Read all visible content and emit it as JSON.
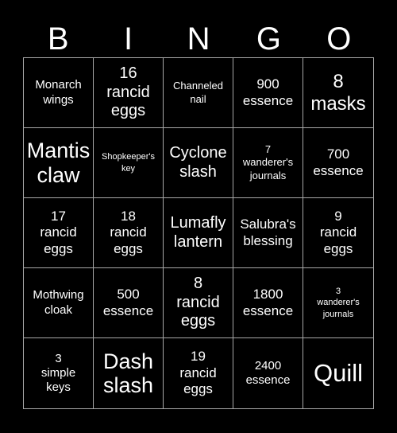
{
  "card": {
    "title": "BINGO",
    "background_color": "#000000",
    "text_color": "#ffffff",
    "grid_line_color": "#a8a8a8",
    "columns": 5,
    "rows": 5
  },
  "header": {
    "letters": [
      {
        "label": "B"
      },
      {
        "label": "I"
      },
      {
        "label": "N"
      },
      {
        "label": "G"
      },
      {
        "label": "O"
      }
    ]
  },
  "grid": {
    "cells": [
      {
        "text": "Monarch\nwings",
        "size": "md"
      },
      {
        "text": "16\nrancid\neggs",
        "size": "xl"
      },
      {
        "text": "Channeled\nnail",
        "size": "sm"
      },
      {
        "text": "900\nessence",
        "size": "lg"
      },
      {
        "text": "8\nmasks",
        "size": "2xl"
      },
      {
        "text": "Mantis\nclaw",
        "size": "3xl"
      },
      {
        "text": "Shopkeeper's\nkey",
        "size": "xs"
      },
      {
        "text": "Cyclone\nslash",
        "size": "xl"
      },
      {
        "text": "7\nwanderer's\njournals",
        "size": "sm"
      },
      {
        "text": "700\nessence",
        "size": "lg"
      },
      {
        "text": "17\nrancid\neggs",
        "size": "lg"
      },
      {
        "text": "18\nrancid\neggs",
        "size": "lg"
      },
      {
        "text": "Lumafly\nlantern",
        "size": "xl"
      },
      {
        "text": "Salubra's\nblessing",
        "size": "lg"
      },
      {
        "text": "9\nrancid\neggs",
        "size": "lg"
      },
      {
        "text": "Mothwing\ncloak",
        "size": "md"
      },
      {
        "text": "500\nessence",
        "size": "lg"
      },
      {
        "text": "8\nrancid\neggs",
        "size": "xl"
      },
      {
        "text": "1800\nessence",
        "size": "lg"
      },
      {
        "text": "3\nwanderer's\njournals",
        "size": "xs"
      },
      {
        "text": "3\nsimple\nkeys",
        "size": "md"
      },
      {
        "text": "Dash\nslash",
        "size": "3xl"
      },
      {
        "text": "19\nrancid\neggs",
        "size": "lg"
      },
      {
        "text": "2400\nessence",
        "size": "md"
      },
      {
        "text": "Quill",
        "size": "4xl"
      }
    ]
  }
}
